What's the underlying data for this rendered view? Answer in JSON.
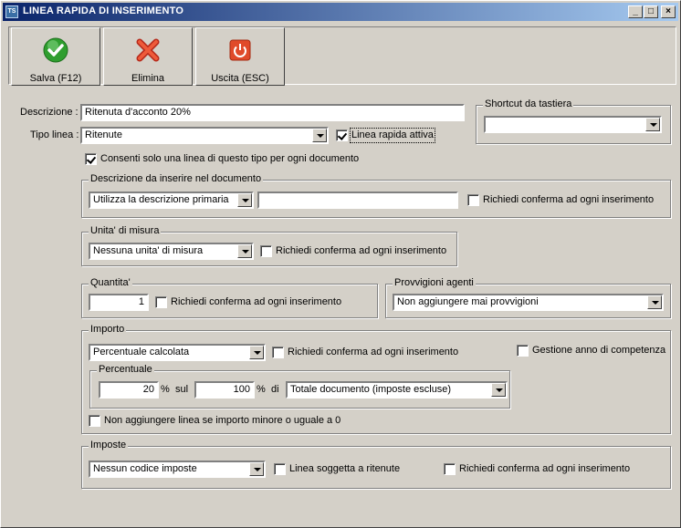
{
  "window": {
    "title": "LINEA RAPIDA DI INSERIMENTO",
    "app_icon_text": "TS",
    "min_glyph": "_",
    "max_glyph": "□",
    "close_glyph": "×"
  },
  "toolbar": {
    "save_label": "Salva (F12)",
    "delete_label": "Elimina",
    "exit_label": "Uscita (ESC)"
  },
  "form": {
    "descrizione_label": "Descrizione :",
    "descrizione_value": "Ritenuta d'acconto 20%",
    "tipo_linea_label": "Tipo linea :",
    "tipo_linea_value": "Ritenute",
    "linea_rapida_attiva": "Linea rapida attiva",
    "consenti_label": "Consenti solo una linea di questo tipo per ogni documento"
  },
  "shortcut": {
    "title": "Shortcut da tastiera",
    "value": ""
  },
  "descrizione_doc": {
    "title": "Descrizione da inserire nel documento",
    "mode_value": "Utilizza la descrizione primaria",
    "text_value": "",
    "confirm_label": "Richiedi conferma ad ogni inserimento"
  },
  "unita": {
    "title": "Unita' di misura",
    "value": "Nessuna unita' di misura",
    "confirm_label": "Richiedi conferma ad ogni inserimento"
  },
  "quantita": {
    "title": "Quantita'",
    "value": "1",
    "confirm_label": "Richiedi conferma ad ogni inserimento"
  },
  "provvigioni": {
    "title": "Provvigioni agenti",
    "value": "Non aggiungere mai provvigioni"
  },
  "importo": {
    "title": "Importo",
    "mode_value": "Percentuale calcolata",
    "confirm_label": "Richiedi conferma ad ogni inserimento",
    "gestione_label": "Gestione anno di competenza",
    "percentuale_title": "Percentuale",
    "percent_value": "20",
    "percent_symbol": "%",
    "sul_label": "sul",
    "base_value": "100",
    "percent_symbol_2": "%",
    "di_label": "di",
    "totale_value": "Totale documento (imposte escluse)",
    "non_aggiungere_label": "Non aggiungere linea se importo minore o uguale a 0"
  },
  "imposte": {
    "title": "Imposte",
    "value": "Nessun codice imposte",
    "soggetta_label": "Linea soggetta a ritenute",
    "confirm_label": "Richiedi conferma ad ogni inserimento"
  }
}
